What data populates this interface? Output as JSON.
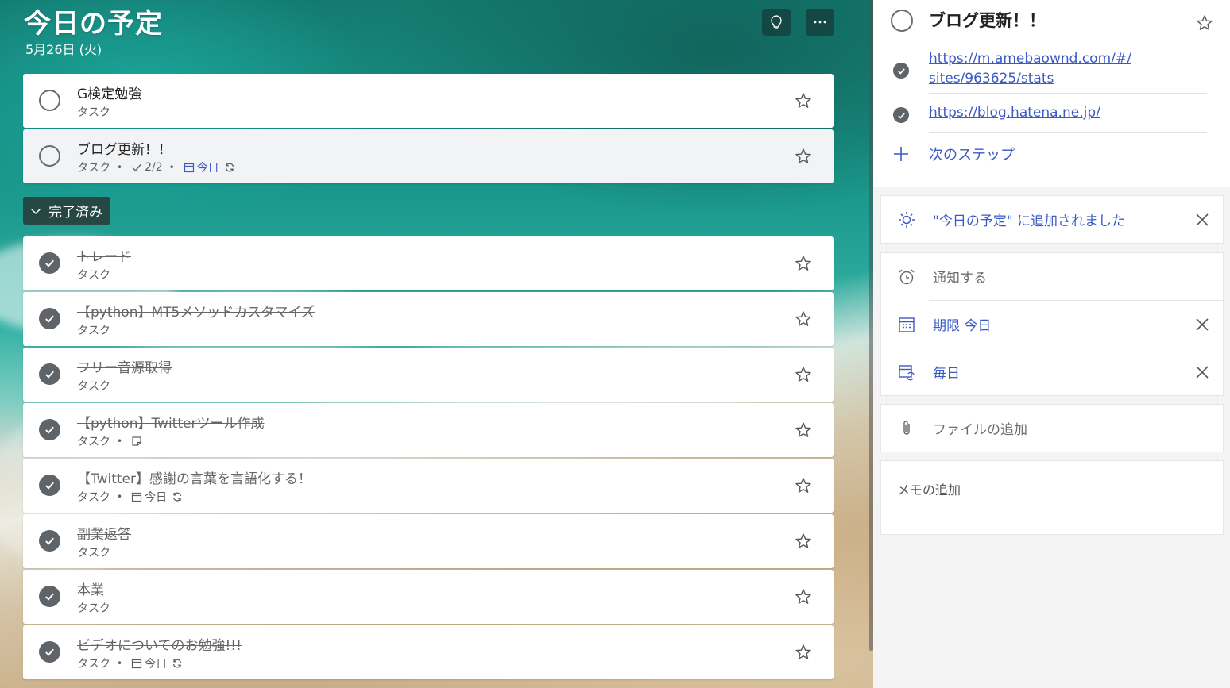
{
  "header": {
    "title": "今日の予定",
    "date": "5月26日 (火)"
  },
  "tasks": [
    {
      "title": "G検定勉強",
      "list": "タスク",
      "done": false
    },
    {
      "title": "ブログ更新！！",
      "list": "タスク",
      "steps": "2/2",
      "due": "今日",
      "repeat": true,
      "done": false,
      "selected": true
    }
  ],
  "completed_section": {
    "label": "完了済み"
  },
  "completed_tasks": [
    {
      "title": "トレード",
      "list": "タスク"
    },
    {
      "title": "【python】MT5メソッドカスタマイズ",
      "list": "タスク"
    },
    {
      "title": "フリー音源取得",
      "list": "タスク"
    },
    {
      "title": "【python】Twitterツール作成",
      "list": "タスク",
      "has_note": true
    },
    {
      "title": "【Twitter】感謝の言葉を言語化する！",
      "list": "タスク",
      "due": "今日",
      "repeat": true
    },
    {
      "title": "副業返答",
      "list": "タスク"
    },
    {
      "title": "本業",
      "list": "タスク"
    },
    {
      "title": "ビデオについてのお勉強!!!",
      "list": "タスク",
      "due": "今日",
      "repeat": true
    }
  ],
  "detail": {
    "title": "ブログ更新！！",
    "steps": [
      {
        "line1": "https://m.amebaownd.com/#/",
        "line2": "sites/963625/stats"
      },
      {
        "line1": "https://blog.hatena.ne.jp/"
      }
    ],
    "add_step_label": "次のステップ",
    "my_day_label": "\"今日の予定\" に追加されました",
    "remind_label": "通知する",
    "due_label": "期限 今日",
    "repeat_label": "毎日",
    "attach_label": "ファイルの追加",
    "note_placeholder": "メモの追加"
  },
  "colors": {
    "accent": "#3b5ac6",
    "check_fill": "#5f6469",
    "card": "#ffffff"
  },
  "icons": [
    "lightbulb-icon",
    "more-icon",
    "star-icon",
    "check-icon",
    "chevron-down-icon",
    "calendar-icon",
    "repeat-icon",
    "note-icon",
    "sun-icon",
    "alarm-icon",
    "close-icon",
    "plus-icon",
    "paperclip-icon"
  ]
}
